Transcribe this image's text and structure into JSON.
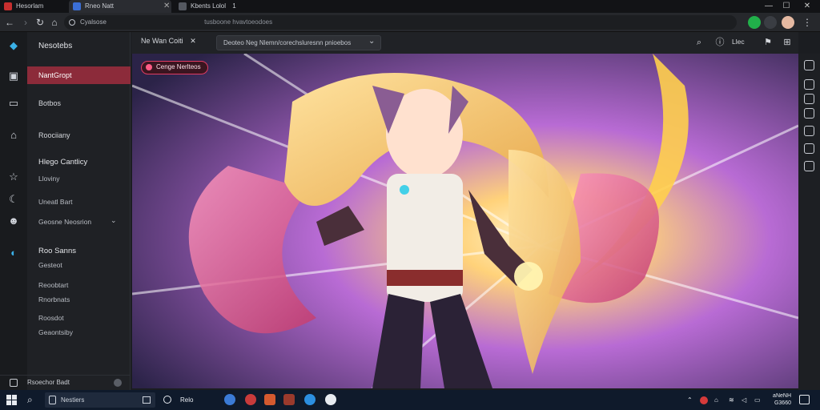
{
  "tabs": [
    {
      "label": "Hesorlam",
      "active": false
    },
    {
      "label": "Rneo Natt",
      "active": true
    },
    {
      "label": "Kbents Lolol",
      "count": "1",
      "active": false
    }
  ],
  "address": {
    "text": "Cyalsose",
    "url": "tusboone hvavtoeodoes"
  },
  "sidebar": {
    "brand": "Nesotebs",
    "items": [
      {
        "label": "NantGropt",
        "icon": "photo-icon",
        "active": true
      },
      {
        "label": "Botbos",
        "icon": "monitor-icon"
      },
      {
        "label": "Roociiany",
        "icon": "home-icon"
      }
    ],
    "group1": {
      "title": "Hlego Cantlicy",
      "items": [
        "Lloviny",
        "Uneatl Bart",
        "Geosne Neosrion"
      ]
    },
    "group2": {
      "title": "Roo Sanns",
      "items": [
        "Gesteot",
        "Reoobtart",
        "Rnorbnats",
        "Roosdot",
        "Geaontsiby"
      ]
    },
    "footer": "Rsoechor Badt"
  },
  "toolbar": {
    "crumb_a": "Ne Wan Coiti",
    "filter": "Deoteo Neg Nlemn/corechsluresnn pnioebos"
  },
  "topright": {
    "label": "Llec"
  },
  "artwork": {
    "chip": "Cenge Nerlteos"
  },
  "taskbar": {
    "search": "Nestiers",
    "app": "Relo",
    "date": "aNeNH",
    "time": "G3660"
  },
  "colors": {
    "accent": "#8c2b3a",
    "chip": "#e03c63",
    "taskbar": "#0f1a2b"
  }
}
